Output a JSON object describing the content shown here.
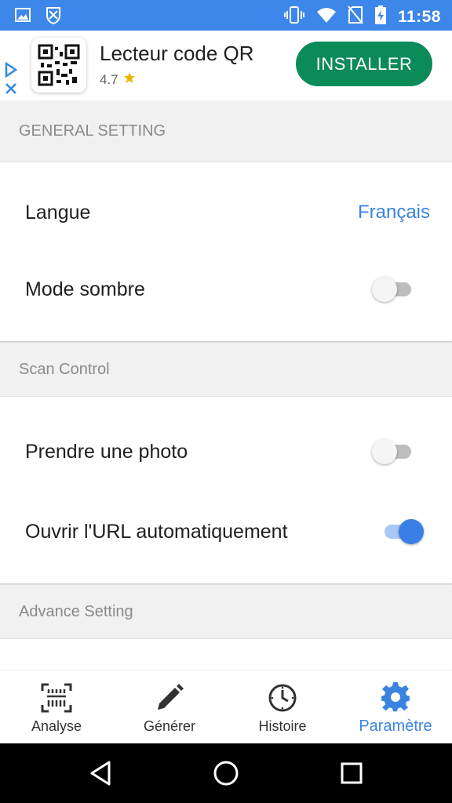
{
  "status_bar": {
    "time": "11:58",
    "icons_left": [
      "image-icon",
      "shield-icon"
    ],
    "icons_right": [
      "vibrate-icon",
      "wifi-icon",
      "no-sim-icon",
      "battery-charging-icon"
    ]
  },
  "ad": {
    "title": "Lecteur code QR",
    "rating": "4.7",
    "install_label": "INSTALLER",
    "install_color": "#0b8a5a"
  },
  "sections": {
    "general": {
      "header": "GENERAL SETTING"
    },
    "scan": {
      "header": "Scan Control"
    },
    "advance": {
      "header": "Advance Setting"
    }
  },
  "settings": {
    "language": {
      "label": "Langue",
      "value": "Français"
    },
    "dark_mode": {
      "label": "Mode sombre",
      "enabled": false
    },
    "take_photo": {
      "label": "Prendre une photo",
      "enabled": false
    },
    "auto_open_url": {
      "label": "Ouvrir l'URL automatiquement",
      "enabled": true
    }
  },
  "bottom_nav": {
    "items": [
      {
        "label": "Analyse",
        "icon": "scan-icon",
        "active": false
      },
      {
        "label": "Générer",
        "icon": "pencil-icon",
        "active": false
      },
      {
        "label": "Histoire",
        "icon": "clock-icon",
        "active": false
      },
      {
        "label": "Paramètre",
        "icon": "gear-icon",
        "active": true
      }
    ]
  },
  "colors": {
    "accent": "#3a84e0",
    "status_bar": "#3d86ea"
  }
}
